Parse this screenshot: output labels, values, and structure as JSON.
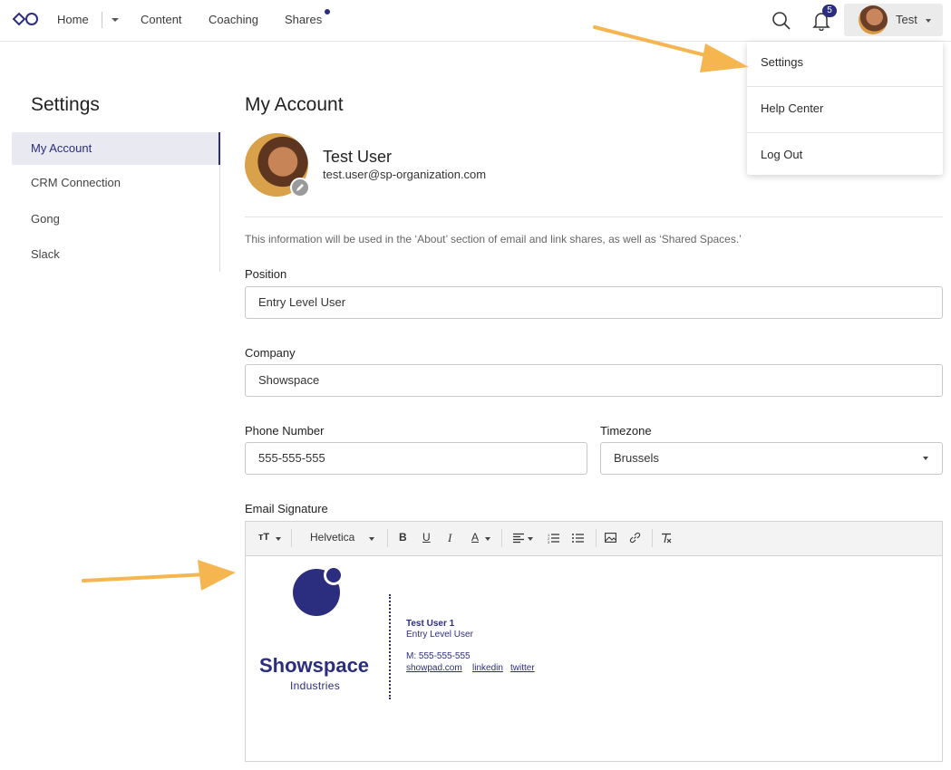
{
  "nav": {
    "items": [
      "Home",
      "Content",
      "Coaching",
      "Shares"
    ],
    "notifications_count": "5",
    "user_label": "Test"
  },
  "user_menu": {
    "items": [
      "Settings",
      "Help Center",
      "Log Out"
    ]
  },
  "sidebar": {
    "title": "Settings",
    "items": [
      {
        "label": "My Account",
        "active": true
      },
      {
        "label": "CRM Connection",
        "active": false
      },
      {
        "label": "Gong",
        "active": false
      },
      {
        "label": "Slack",
        "active": false
      }
    ]
  },
  "main": {
    "title": "My Account",
    "profile": {
      "name": "Test User",
      "email": "test.user@sp-organization.com"
    },
    "info": "This information will be used in the ‘About’ section of email and link shares, as well as ‘Shared Spaces.’",
    "fields": {
      "position": {
        "label": "Position",
        "value": "Entry Level User"
      },
      "company": {
        "label": "Company",
        "value": "Showspace"
      },
      "phone": {
        "label": "Phone Number",
        "value": "555-555-555"
      },
      "timezone": {
        "label": "Timezone",
        "value": "Brussels"
      }
    },
    "signature": {
      "label": "Email Signature",
      "toolbar": {
        "font": "Helvetica"
      },
      "brand": "Showspace",
      "brand_sub": "Industries",
      "name": "Test User 1",
      "position": "Entry Level User",
      "phone": "M: 555-555-555",
      "links": [
        "showpad.com",
        "linkedin",
        "twitter"
      ]
    }
  },
  "colors": {
    "accent": "#2b2d7e",
    "annotation_arrow": "#f5b650"
  }
}
